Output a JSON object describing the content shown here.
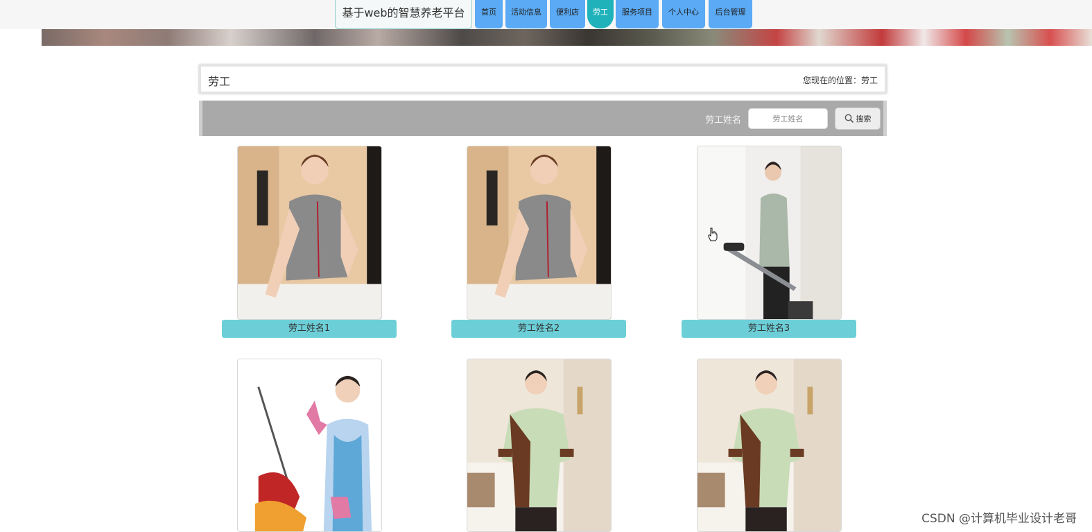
{
  "header": {
    "site_title": "基于web的智慧养老平台",
    "nav": [
      {
        "label": "首页",
        "active": false
      },
      {
        "label": "活动信息",
        "active": false
      },
      {
        "label": "便利店",
        "active": false
      },
      {
        "label": "劳工",
        "active": true
      },
      {
        "label": "服务项目",
        "active": false
      },
      {
        "label": "个人中心",
        "active": false
      },
      {
        "label": "后台管理",
        "active": false
      }
    ]
  },
  "breadcrumb": {
    "title": "劳工",
    "location": "您现在的位置：劳工"
  },
  "search": {
    "label": "劳工姓名",
    "placeholder": "劳工姓名",
    "button_label": "搜索"
  },
  "workers": [
    {
      "name": "劳工姓名1"
    },
    {
      "name": "劳工姓名2"
    },
    {
      "name": "劳工姓名3"
    },
    {
      "name": ""
    },
    {
      "name": ""
    },
    {
      "name": ""
    }
  ],
  "watermark": "CSDN @计算机毕业设计老哥",
  "colors": {
    "nav_bg": "#5aaaf5",
    "nav_active": "#20b2bb",
    "card_label_bg": "#6ccfd8",
    "search_bar_bg": "#a9a9a9"
  }
}
